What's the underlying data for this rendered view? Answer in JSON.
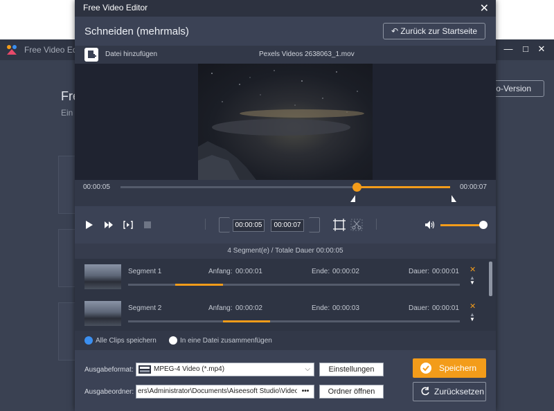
{
  "background_app": {
    "title": "Free Video Edi",
    "heading": "Fre",
    "subheading": "Ein",
    "pro_button": "ro-Version"
  },
  "dialog": {
    "title": "Free Video Editor",
    "heading": "Schneiden (mehrmals)",
    "back_button": "Zurück zur Startseite",
    "add_file": "Datei hinzufügen",
    "file_name": "Pexels Videos 2638063_1.mov"
  },
  "timeline": {
    "start_time": "00:00:05",
    "end_time": "00:00:07",
    "playhead_fraction": 0.716,
    "selection_start_fraction": 0.716,
    "selection_end_fraction": 1.0
  },
  "controls": {
    "clip_start": "00:00:05",
    "clip_end": "00:00:07",
    "volume_fraction": 0.9
  },
  "segments_summary": "4 Segment(e) / Totale Dauer 00:00:05",
  "segments": [
    {
      "name": "Segment 1",
      "start_label": "Anfang:",
      "start": "00:00:01",
      "end_label": "Ende:",
      "end": "00:00:02",
      "duration_label": "Dauer:",
      "duration": "00:00:01",
      "bar_start_fraction": 0.143,
      "bar_end_fraction": 0.286
    },
    {
      "name": "Segment 2",
      "start_label": "Anfang:",
      "start": "00:00:02",
      "end_label": "Ende:",
      "end": "00:00:03",
      "duration_label": "Dauer:",
      "duration": "00:00:01",
      "bar_start_fraction": 0.286,
      "bar_end_fraction": 0.429
    }
  ],
  "options": {
    "save_all": "Alle Clips speichern",
    "merge": "In eine Datei zusammenfügen",
    "selected": "save_all"
  },
  "output": {
    "format_label": "Ausgabeformat:",
    "format_value": "MPEG-4 Video (*.mp4)",
    "settings_button": "Einstellungen",
    "folder_label": "Ausgabeordner:",
    "folder_path": "ers\\Administrator\\Documents\\Aiseesoft Studio\\Video",
    "browse": "•••",
    "open_folder_button": "Ordner öffnen",
    "save_button": "Speichern",
    "reset_button": "Zurücksetzen"
  },
  "colors": {
    "accent": "#f39c1a",
    "radio_selected": "#3b8ff0",
    "dialog_bg": "#3b4255",
    "titlebar_bg": "#2d3240"
  }
}
